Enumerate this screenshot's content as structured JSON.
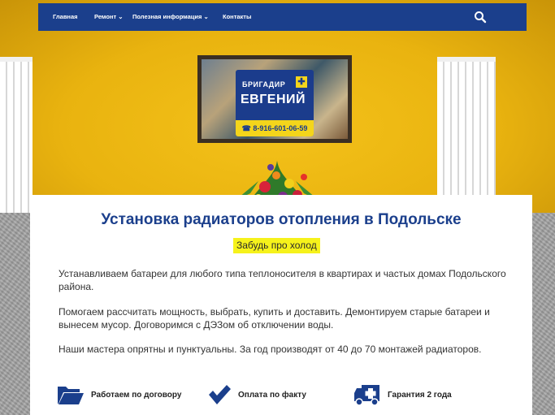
{
  "nav": {
    "items": [
      {
        "label": "Главная"
      },
      {
        "label": "Ремонт ⌄"
      },
      {
        "label": "Полезная информация ⌄"
      },
      {
        "label": "Контакты"
      }
    ],
    "search_icon": "search-icon"
  },
  "hero": {
    "logo": {
      "line1": "БРИГАДИР",
      "line2": "ЕВГЕНИЙ",
      "phone": "8-916-601-06-59"
    }
  },
  "content": {
    "title": "Установка радиаторов отопления в Подольске",
    "tagline": "Забудь про холод",
    "paragraphs": [
      "Устанавливаем батареи для любого типа теплоносителя в квартирах и частых домах Подольского района.",
      "Помогаем рассчитать мощность, выбрать, купить и доставить. Демонтируем старые батареи и вынесем мусор. Договоримся с ДЭЗом об отключении воды.",
      "Наши мастера опрятны и пунктуальны. За год производят от 40 до 70 монтажей радиаторов."
    ],
    "features": [
      {
        "label": "Работаем по договору",
        "icon": "folder-icon"
      },
      {
        "label": "Оплата по факту",
        "icon": "checkmark-icon"
      },
      {
        "label": "Гарантия 2 года",
        "icon": "medical-truck-icon"
      }
    ]
  },
  "colors": {
    "brand_blue": "#1b3f8c",
    "highlight_yellow": "#f6f21b",
    "wall_yellow": "#e9b30f"
  }
}
